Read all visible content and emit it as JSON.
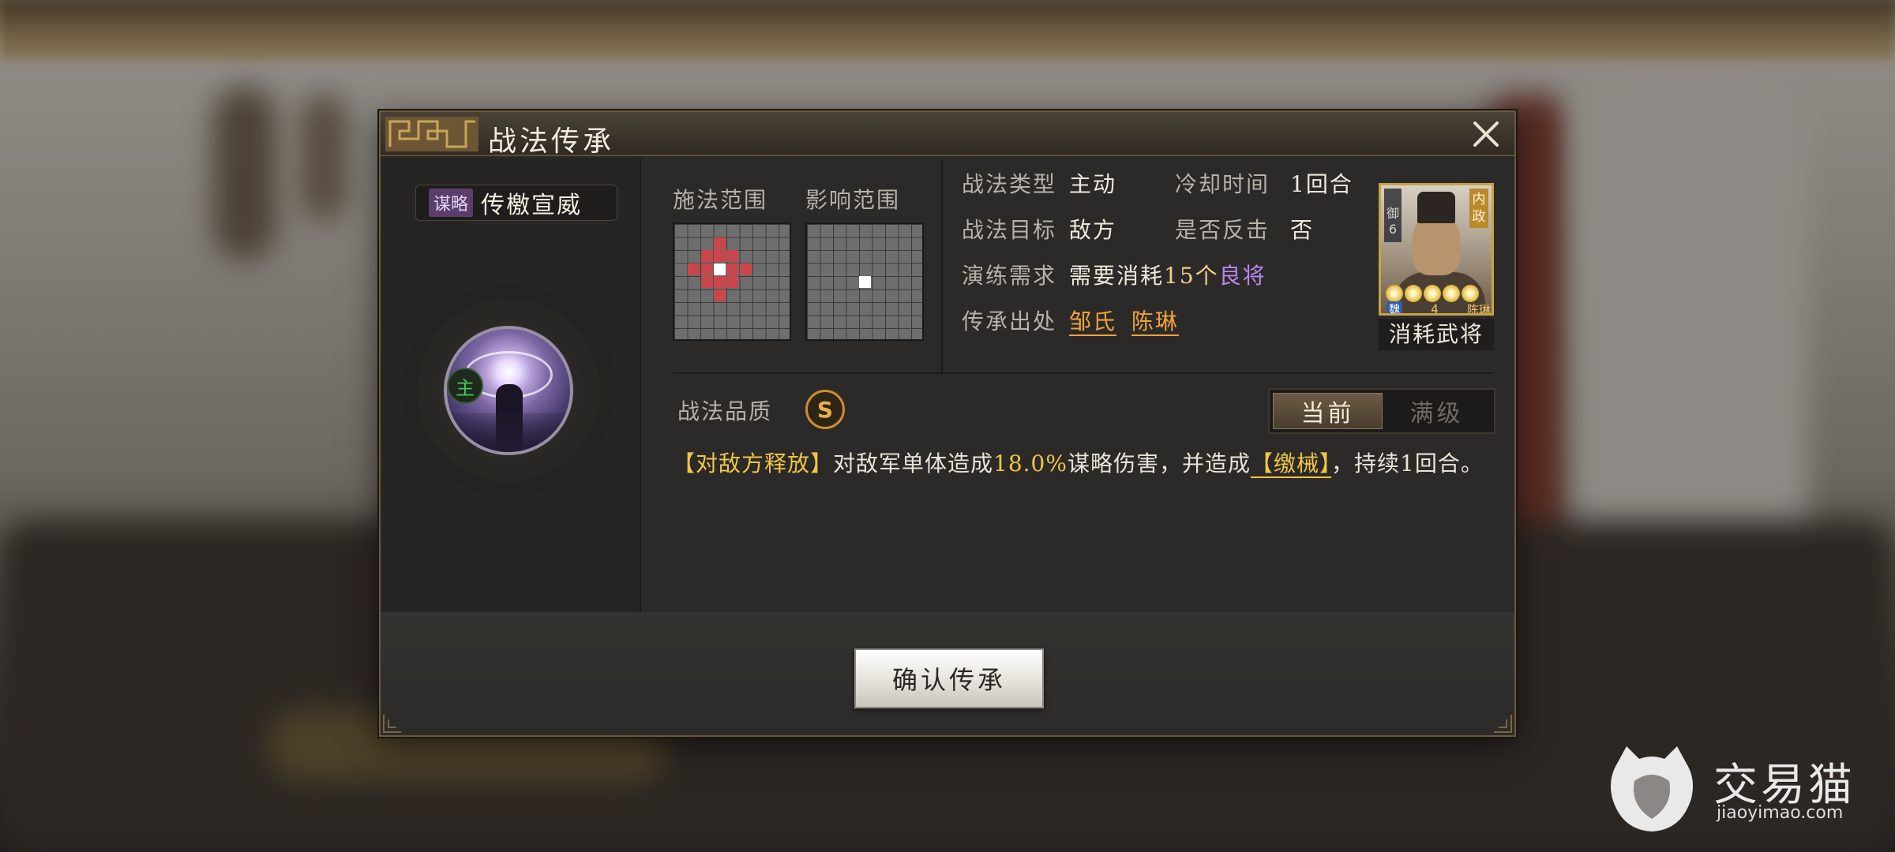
{
  "dialog": {
    "title": "战法传承",
    "close_icon": "close-icon"
  },
  "skill": {
    "tag": "谋略",
    "name": "传檄宣威",
    "role_badge": "主",
    "icon": "eye-skill-icon"
  },
  "ranges": {
    "cast_label": "施法范围",
    "effect_label": "影响范围"
  },
  "info": {
    "type_label": "战法类型",
    "type_value": "主动",
    "cooldown_label": "冷却时间",
    "cooldown_value": "1回合",
    "target_label": "战法目标",
    "target_value": "敌方",
    "counter_label": "是否反击",
    "counter_value": "否",
    "require_label": "演练需求",
    "require_prefix": "需要消耗",
    "require_count": "15个",
    "require_grade": "良将",
    "source_label": "传承出处",
    "source_1": "邹氏",
    "source_2": "陈琳"
  },
  "general_card": {
    "left_tag": "御",
    "left_tag_num": "6",
    "right_tag": "内政",
    "faction": "魏",
    "cost": "4",
    "name": "陈琳",
    "stars": 5,
    "caption": "消耗武将"
  },
  "quality": {
    "label": "战法品质",
    "grade": "S"
  },
  "level_toggle": {
    "current": "当前",
    "max": "满级"
  },
  "description": {
    "p1": "【对敌方释放】",
    "p2": "对敌军单体造成",
    "p3": "18.0%",
    "p4": "谋略伤害，并造成",
    "p5": "【缴械】",
    "p6": "，持续1回合。"
  },
  "footer": {
    "confirm_label": "确认传承"
  },
  "watermark": {
    "brand": "交易猫",
    "domain": "jiaoyimao.com"
  },
  "colors": {
    "accent_gold": "#f0c642",
    "accent_orange": "#f0a23a",
    "accent_purple": "#b987f0",
    "grid_highlight": "#c9464c"
  }
}
